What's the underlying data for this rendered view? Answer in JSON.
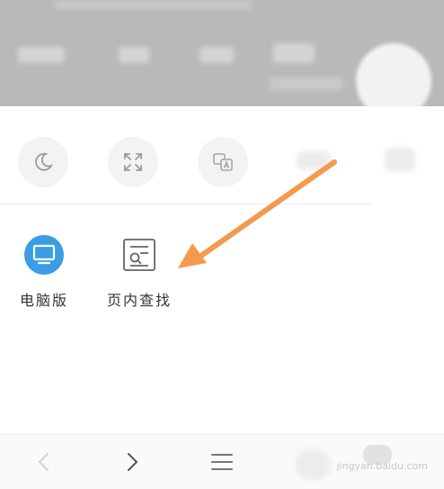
{
  "menu": {
    "items": [
      {
        "label": "电脑版",
        "icon": "desktop-monitor-icon"
      },
      {
        "label": "页内查找",
        "icon": "find-in-page-icon"
      }
    ],
    "quick_tools": [
      "night-mode-icon",
      "fullscreen-icon",
      "translate-icon"
    ]
  },
  "bottom_bar": {
    "icons": [
      "back-arrow-icon",
      "forward-arrow-icon",
      "menu-icon"
    ]
  },
  "watermark": {
    "text": "jingyan.baidu.com"
  },
  "colors": {
    "accent_blue": "#3a9ee4",
    "annotation_arrow": "#f39a4e"
  }
}
